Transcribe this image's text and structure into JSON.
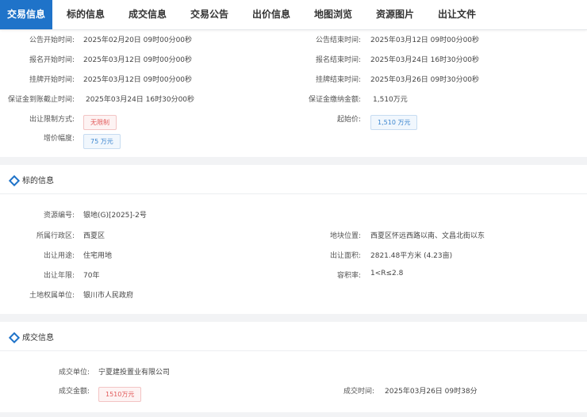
{
  "tabs": [
    "交易信息",
    "标的信息",
    "成交信息",
    "交易公告",
    "出价信息",
    "地图浏览",
    "资源图片",
    "出让文件"
  ],
  "trade": {
    "announce_start_label": "公告开始时间:",
    "announce_start": "2025年02月20日 09时00分00秒",
    "announce_end_label": "公告结束时间:",
    "announce_end": "2025年03月12日 09时00分00秒",
    "signup_start_label": "报名开始时间:",
    "signup_start": "2025年03月12日 09时00分00秒",
    "signup_end_label": "报名结束时间:",
    "signup_end": "2025年03月24日 16时30分00秒",
    "listing_start_label": "挂牌开始时间:",
    "listing_start": "2025年03月12日 09时00分00秒",
    "listing_end_label": "挂牌结束时间:",
    "listing_end": "2025年03月26日 09时30分00秒",
    "deposit_deadline_label": "保证金到账截止时间:",
    "deposit_deadline": "2025年03月24日 16时30分00秒",
    "deposit_amount_label": "保证金缴纳金额:",
    "deposit_amount": "1,510万元",
    "restriction_label": "出让限制方式:",
    "restriction": "无限制",
    "start_price_label": "起始价:",
    "start_price": "1,510 万元",
    "increment_label": "增价幅度:",
    "increment": "75 万元"
  },
  "subject": {
    "title": "标的信息",
    "code_label": "资源编号:",
    "code": "银地(G)[2025]-2号",
    "location_label": "地块位置:",
    "location": "西夏区怀远西路以南、文昌北街以东",
    "district_label": "所属行政区:",
    "district": "西夏区",
    "usage_label": "出让用途:",
    "usage": "住宅用地",
    "area_label": "出让面积:",
    "area": "2821.48平方米 (4.23亩)",
    "years_label": "出让年限:",
    "years": "70年",
    "far_label": "容积率:",
    "far": "1<R≤2.8",
    "owner_label": "土地权属单位:",
    "owner": "银川市人民政府"
  },
  "deal": {
    "title": "成交信息",
    "unit_label": "成交单位:",
    "unit": "宁夏建投置业有限公司",
    "amount_label": "成交金额:",
    "amount": "1510万元",
    "time_label": "成交时间:",
    "time": "2025年03月26日 09时38分"
  }
}
